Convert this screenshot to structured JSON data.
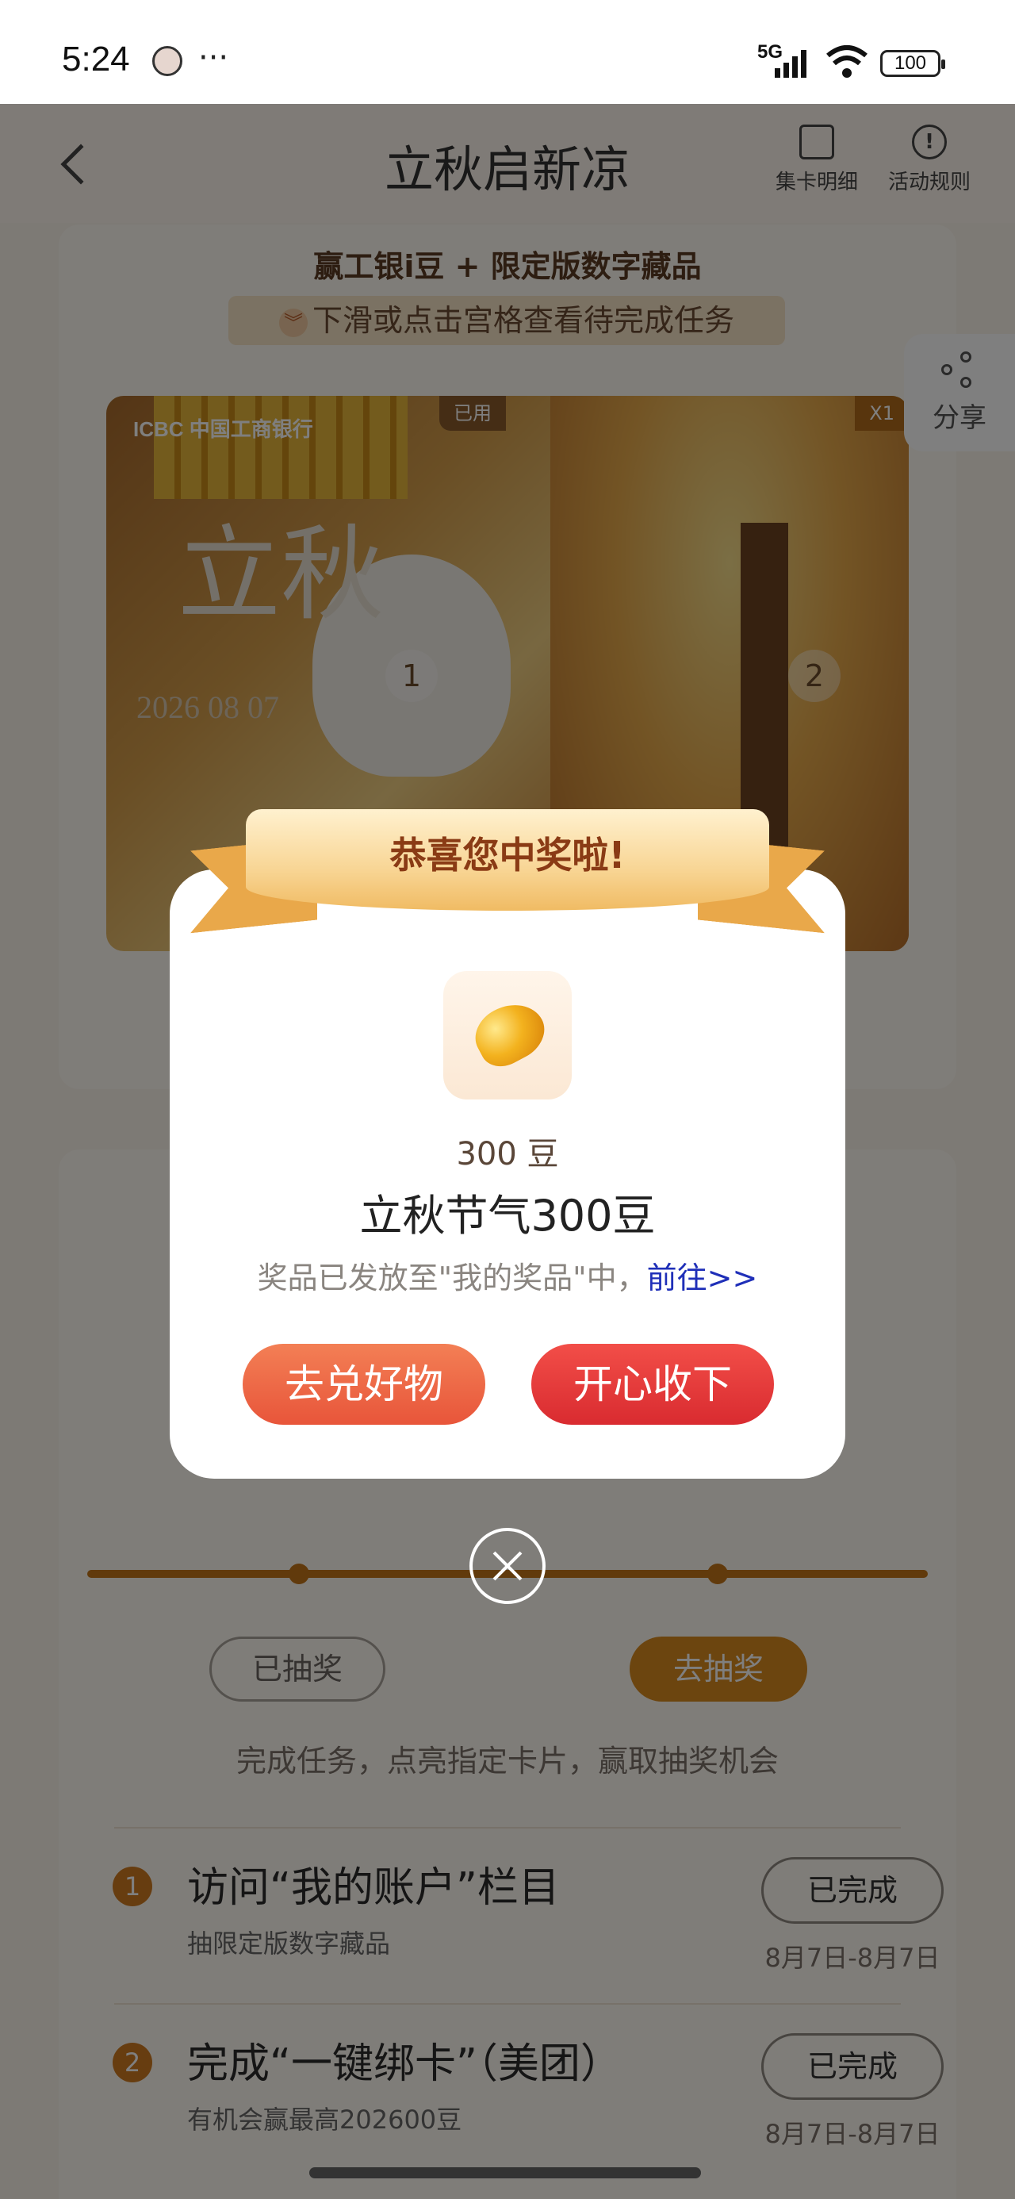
{
  "status_bar": {
    "time": "5:24",
    "more": "···",
    "network": "5G",
    "battery": "100"
  },
  "nav": {
    "title": "立秋启新凉",
    "card_detail": "集卡明细",
    "rules": "活动规则"
  },
  "campaign": {
    "subtitle": "赢工银i豆 + 限定版数字藏品",
    "hint": "下滑或点击宫格查看待完成任务",
    "art": {
      "bank": "ICBC 中国工商银行",
      "calligraphy": "立秋",
      "date": "2026 08 07",
      "badge_used": "已用",
      "badge_count": "X1",
      "cell_1": "1",
      "cell_2": "2"
    }
  },
  "share": {
    "label": "分享"
  },
  "draw": {
    "done_label": "已抽奖",
    "go_label": "去抽奖",
    "hint": "完成任务，点亮指定卡片，赢取抽奖机会"
  },
  "tasks": [
    {
      "index": "1",
      "title": "访问“我的账户”栏目",
      "sub": "抽限定版数字藏品",
      "status": "已完成",
      "period": "8月7日-8月7日"
    },
    {
      "index": "2",
      "title": "完成“一键绑卡”（美团）",
      "sub": "有机会赢最高202600豆",
      "status": "已完成",
      "period": "8月7日-8月7日"
    }
  ],
  "modal": {
    "ribbon": "恭喜您中奖啦!",
    "prize_amount": "300 豆",
    "prize_name": "立秋节气300豆",
    "note": "奖品已发放至\"我的奖品\"中，",
    "note_link": "前往>>",
    "redeem_label": "去兑好物",
    "accept_label": "开心收下"
  },
  "colors": {
    "accent": "#d88a1e",
    "overlay": "#000000",
    "button_red": "#d92b30",
    "button_orange": "#e8553a"
  }
}
